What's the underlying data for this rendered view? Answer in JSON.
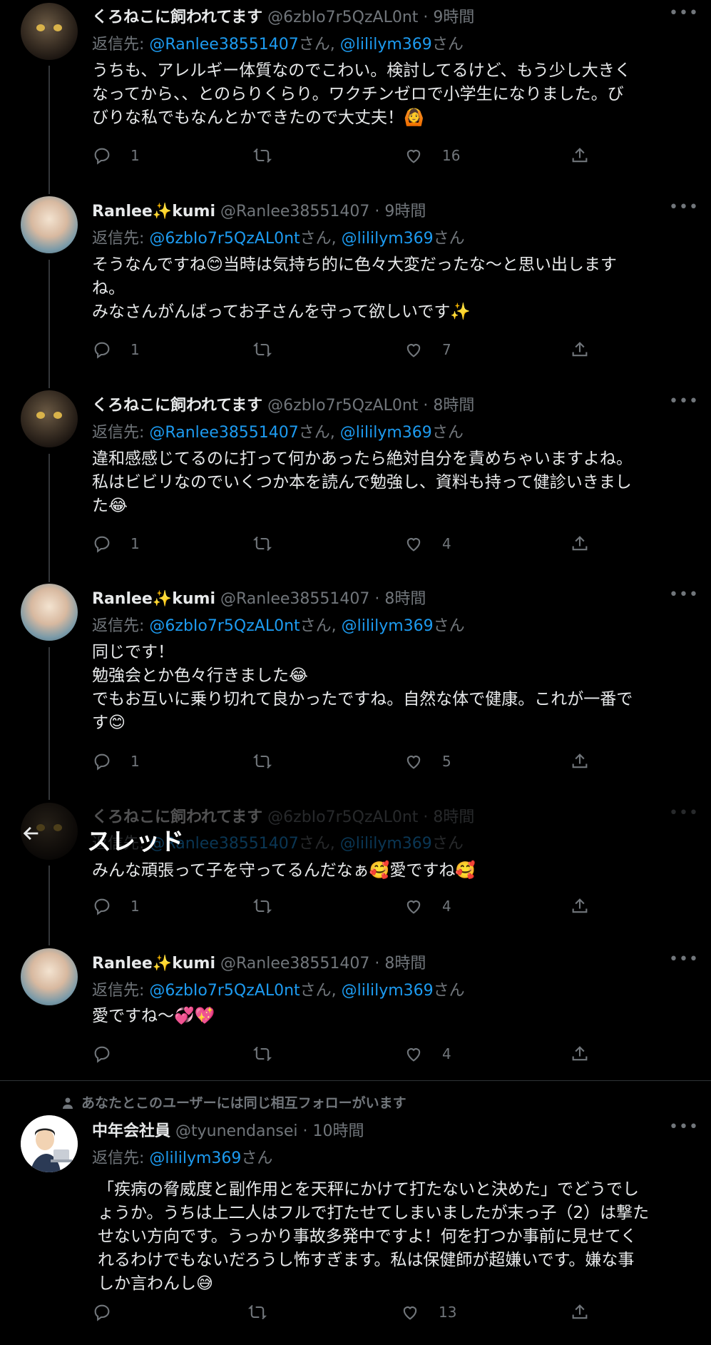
{
  "header": {
    "title": "スレッド",
    "back_icon": "arrow-left-icon"
  },
  "tweets": [
    {
      "name": "くろねこに飼われてます",
      "handle": "@6zbIo7r5QzAL0nt",
      "time": "9時間",
      "reply_prefix": "返信先: ",
      "mention1": "@Ranlee38551407",
      "san1": "さん, ",
      "mention2": "@lililym369",
      "san2": "さん",
      "text": "うちも、アレルギー体質なのでこわい。検討してるけど、もう少し大きく\nなってから、、とのらりくらり。ワクチンゼロで小学生になりました。び\nびりな私でもなんとかできたので大丈夫！🙆",
      "reply_count": "1",
      "retweet_count": "",
      "like_count": "16"
    },
    {
      "name": "Ranlee✨kumi",
      "handle": "@Ranlee38551407",
      "time": "9時間",
      "reply_prefix": "返信先: ",
      "mention1": "@6zbIo7r5QzAL0nt",
      "san1": "さん, ",
      "mention2": "@lililym369",
      "san2": "さん",
      "text": "そうなんですね😊当時は気持ち的に色々大変だったな〜と思い出します\nね。\nみなさんがんばってお子さんを守って欲しいです✨",
      "reply_count": "1",
      "retweet_count": "",
      "like_count": "7"
    },
    {
      "name": "くろねこに飼われてます",
      "handle": "@6zbIo7r5QzAL0nt",
      "time": "8時間",
      "reply_prefix": "返信先: ",
      "mention1": "@Ranlee38551407",
      "san1": "さん, ",
      "mention2": "@lililym369",
      "san2": "さん",
      "text": "違和感感じてるのに打って何かあったら絶対自分を責めちゃいますよね。\n私はビビリなのでいくつか本を読んで勉強し、資料も持って健診いきまし\nた😂",
      "reply_count": "1",
      "retweet_count": "",
      "like_count": "4"
    },
    {
      "name": "Ranlee✨kumi",
      "handle": "@Ranlee38551407",
      "time": "8時間",
      "reply_prefix": "返信先: ",
      "mention1": "@6zbIo7r5QzAL0nt",
      "san1": "さん, ",
      "mention2": "@lililym369",
      "san2": "さん",
      "text": "同じです！\n勉強会とか色々行きました😂\nでもお互いに乗り切れて良かったですね。自然な体で健康。これが一番で\nす😊",
      "reply_count": "1",
      "retweet_count": "",
      "like_count": "5"
    },
    {
      "name": "くろねこに飼われてます",
      "handle": "@6zbIo7r5QzAL0nt",
      "time": "8時間",
      "reply_prefix": "返信先: ",
      "mention1": "@Ranlee38551407",
      "san1": "さん, ",
      "mention2": "@lililym369",
      "san2": "さん",
      "text": "みんな頑張って子を守ってるんだなぁ🥰愛ですね🥰",
      "reply_count": "1",
      "retweet_count": "",
      "like_count": "4"
    },
    {
      "name": "Ranlee✨kumi",
      "handle": "@Ranlee38551407",
      "time": "8時間",
      "reply_prefix": "返信先: ",
      "mention1": "@6zbIo7r5QzAL0nt",
      "san1": "さん, ",
      "mention2": "@lililym369",
      "san2": "さん",
      "text": "愛ですね〜💞💖",
      "reply_count": "",
      "retweet_count": "",
      "like_count": "4"
    },
    {
      "social_context": "あなたとこのユーザーには同じ相互フォローがいます",
      "name": "中年会社員",
      "handle": "@tyunendansei",
      "time": "10時間",
      "reply_prefix": "返信先: ",
      "mention1": "@lililym369",
      "san1": "さん",
      "text": "「疾病の脅威度と副作用とを天秤にかけて打たないと決めた」でどうでし\nょうか。うちは上二人はフルで打たせてしまいましたが末っ子（2）は撃た\nせない方向です。うっかり事故多発中ですよ！何を打つか事前に見せてく\nれるわけでもないだろうし怖すぎます。私は保健師が超嫌いです。嫌な事\nしか言わんし😅",
      "reply_count": "",
      "retweet_count": "",
      "like_count": "13"
    }
  ],
  "icons": {
    "reply": "reply-icon",
    "retweet": "retweet-icon",
    "like": "heart-icon",
    "share": "share-icon",
    "more": "more-icon",
    "person": "person-icon"
  },
  "more_glyph": "•••",
  "colors": {
    "background": "#000000",
    "link": "#1d9bf0",
    "muted": "#71767b",
    "text": "#e7e9ea"
  }
}
